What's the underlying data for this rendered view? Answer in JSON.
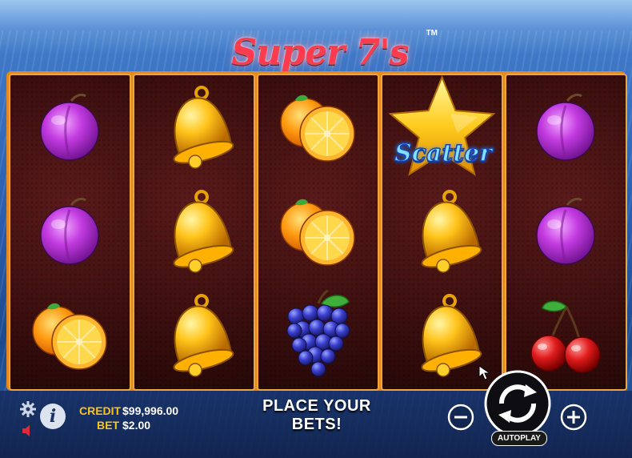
{
  "game": {
    "logo_text": "Super 7's",
    "logo_tm": "TM"
  },
  "reels": [
    [
      "plum",
      "plum",
      "orange"
    ],
    [
      "bell",
      "bell",
      "bell"
    ],
    [
      "orange",
      "orange",
      "grapes"
    ],
    [
      "scatter-star",
      "bell",
      "bell"
    ],
    [
      "plum",
      "plum",
      "cherries"
    ]
  ],
  "scatter_label": "Scatter",
  "status": {
    "credit_label": "CREDIT",
    "credit_value": "$99,996.00",
    "bet_label": "BET",
    "bet_value": "$2.00",
    "message": "PLACE YOUR BETS!"
  },
  "controls": {
    "autoplay_label": "AUTOPLAY",
    "minus_icon": "minus-icon",
    "plus_icon": "plus-icon",
    "spin_icon": "spin-arrows-icon",
    "settings_icon": "gear-icon",
    "info_icon": "info-icon",
    "sound_icon": "speaker-icon"
  },
  "colors": {
    "reel_frame": "#e38a1f",
    "credit_label": "#f7c51e",
    "logo": "#ff3b4f"
  }
}
